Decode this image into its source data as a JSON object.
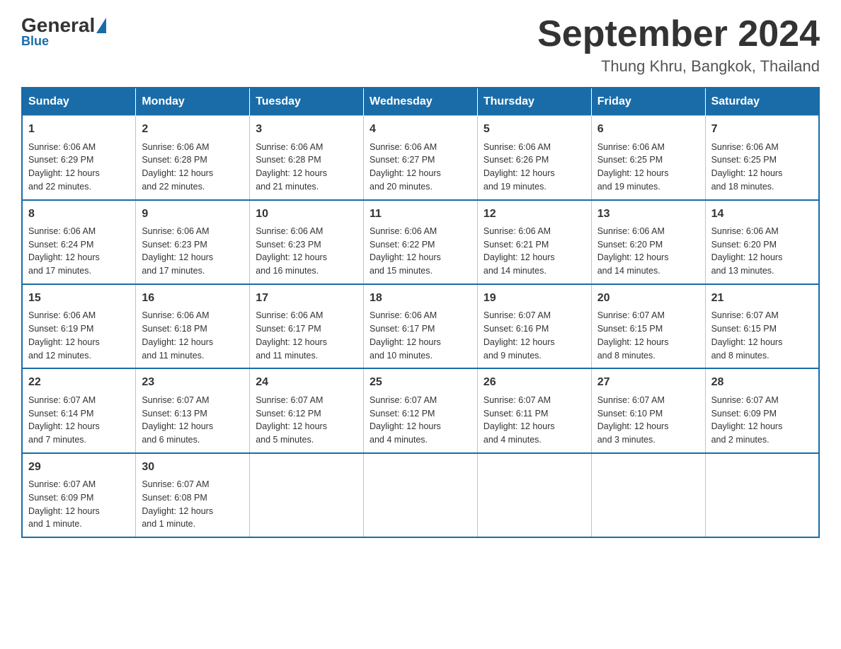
{
  "header": {
    "logo_general": "General",
    "logo_blue": "Blue",
    "month_title": "September 2024",
    "location": "Thung Khru, Bangkok, Thailand"
  },
  "calendar": {
    "days_of_week": [
      "Sunday",
      "Monday",
      "Tuesday",
      "Wednesday",
      "Thursday",
      "Friday",
      "Saturday"
    ],
    "weeks": [
      [
        {
          "day": "",
          "info": ""
        },
        {
          "day": "",
          "info": ""
        },
        {
          "day": "",
          "info": ""
        },
        {
          "day": "",
          "info": ""
        },
        {
          "day": "",
          "info": ""
        },
        {
          "day": "",
          "info": ""
        },
        {
          "day": "",
          "info": ""
        }
      ]
    ],
    "cells": [
      {
        "day": "1",
        "sunrise": "6:06 AM",
        "sunset": "6:29 PM",
        "daylight": "12 hours and 22 minutes."
      },
      {
        "day": "2",
        "sunrise": "6:06 AM",
        "sunset": "6:28 PM",
        "daylight": "12 hours and 22 minutes."
      },
      {
        "day": "3",
        "sunrise": "6:06 AM",
        "sunset": "6:28 PM",
        "daylight": "12 hours and 21 minutes."
      },
      {
        "day": "4",
        "sunrise": "6:06 AM",
        "sunset": "6:27 PM",
        "daylight": "12 hours and 20 minutes."
      },
      {
        "day": "5",
        "sunrise": "6:06 AM",
        "sunset": "6:26 PM",
        "daylight": "12 hours and 19 minutes."
      },
      {
        "day": "6",
        "sunrise": "6:06 AM",
        "sunset": "6:25 PM",
        "daylight": "12 hours and 19 minutes."
      },
      {
        "day": "7",
        "sunrise": "6:06 AM",
        "sunset": "6:25 PM",
        "daylight": "12 hours and 18 minutes."
      },
      {
        "day": "8",
        "sunrise": "6:06 AM",
        "sunset": "6:24 PM",
        "daylight": "12 hours and 17 minutes."
      },
      {
        "day": "9",
        "sunrise": "6:06 AM",
        "sunset": "6:23 PM",
        "daylight": "12 hours and 17 minutes."
      },
      {
        "day": "10",
        "sunrise": "6:06 AM",
        "sunset": "6:23 PM",
        "daylight": "12 hours and 16 minutes."
      },
      {
        "day": "11",
        "sunrise": "6:06 AM",
        "sunset": "6:22 PM",
        "daylight": "12 hours and 15 minutes."
      },
      {
        "day": "12",
        "sunrise": "6:06 AM",
        "sunset": "6:21 PM",
        "daylight": "12 hours and 14 minutes."
      },
      {
        "day": "13",
        "sunrise": "6:06 AM",
        "sunset": "6:20 PM",
        "daylight": "12 hours and 14 minutes."
      },
      {
        "day": "14",
        "sunrise": "6:06 AM",
        "sunset": "6:20 PM",
        "daylight": "12 hours and 13 minutes."
      },
      {
        "day": "15",
        "sunrise": "6:06 AM",
        "sunset": "6:19 PM",
        "daylight": "12 hours and 12 minutes."
      },
      {
        "day": "16",
        "sunrise": "6:06 AM",
        "sunset": "6:18 PM",
        "daylight": "12 hours and 11 minutes."
      },
      {
        "day": "17",
        "sunrise": "6:06 AM",
        "sunset": "6:17 PM",
        "daylight": "12 hours and 11 minutes."
      },
      {
        "day": "18",
        "sunrise": "6:06 AM",
        "sunset": "6:17 PM",
        "daylight": "12 hours and 10 minutes."
      },
      {
        "day": "19",
        "sunrise": "6:07 AM",
        "sunset": "6:16 PM",
        "daylight": "12 hours and 9 minutes."
      },
      {
        "day": "20",
        "sunrise": "6:07 AM",
        "sunset": "6:15 PM",
        "daylight": "12 hours and 8 minutes."
      },
      {
        "day": "21",
        "sunrise": "6:07 AM",
        "sunset": "6:15 PM",
        "daylight": "12 hours and 8 minutes."
      },
      {
        "day": "22",
        "sunrise": "6:07 AM",
        "sunset": "6:14 PM",
        "daylight": "12 hours and 7 minutes."
      },
      {
        "day": "23",
        "sunrise": "6:07 AM",
        "sunset": "6:13 PM",
        "daylight": "12 hours and 6 minutes."
      },
      {
        "day": "24",
        "sunrise": "6:07 AM",
        "sunset": "6:12 PM",
        "daylight": "12 hours and 5 minutes."
      },
      {
        "day": "25",
        "sunrise": "6:07 AM",
        "sunset": "6:12 PM",
        "daylight": "12 hours and 4 minutes."
      },
      {
        "day": "26",
        "sunrise": "6:07 AM",
        "sunset": "6:11 PM",
        "daylight": "12 hours and 4 minutes."
      },
      {
        "day": "27",
        "sunrise": "6:07 AM",
        "sunset": "6:10 PM",
        "daylight": "12 hours and 3 minutes."
      },
      {
        "day": "28",
        "sunrise": "6:07 AM",
        "sunset": "6:09 PM",
        "daylight": "12 hours and 2 minutes."
      },
      {
        "day": "29",
        "sunrise": "6:07 AM",
        "sunset": "6:09 PM",
        "daylight": "12 hours and 1 minute."
      },
      {
        "day": "30",
        "sunrise": "6:07 AM",
        "sunset": "6:08 PM",
        "daylight": "12 hours and 1 minute."
      }
    ]
  }
}
